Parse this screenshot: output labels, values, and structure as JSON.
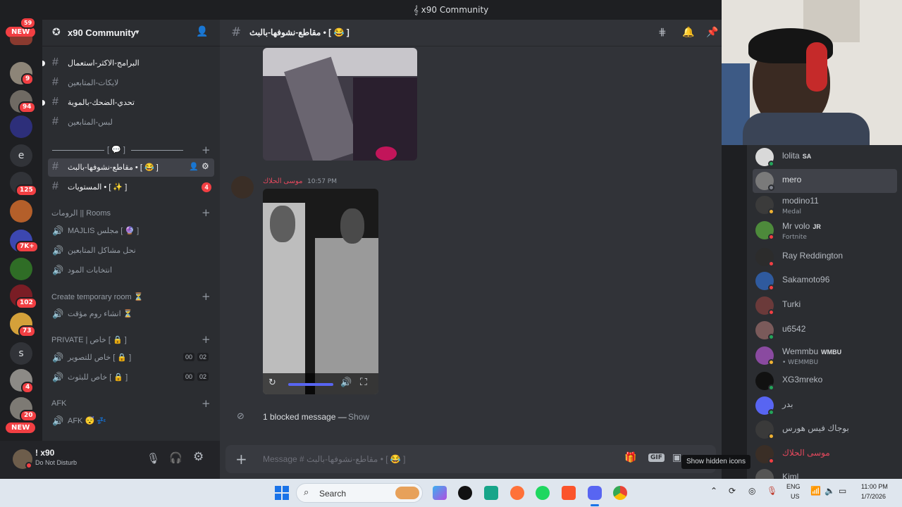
{
  "window": {
    "title": "x90 Community"
  },
  "server_rail": {
    "badges": [
      "59",
      "9",
      "94",
      "125",
      "7K+",
      "102",
      "73",
      "4",
      "20"
    ],
    "new_label": "NEW",
    "letters": [
      "e",
      "s"
    ]
  },
  "guild": {
    "name": "x90 Community"
  },
  "sidebar": {
    "channels_top": [
      {
        "label": "البرامج-الاكثر-استعمال",
        "unread": true
      },
      {
        "label": "لايكات-المتابعين",
        "unread": false
      },
      {
        "label": "تحدي-الضحك-بالموية",
        "unread": true
      },
      {
        "label": "لبس-المتابعين",
        "unread": false
      }
    ],
    "divider_category": "[ 💬 ]",
    "active_channel": "مقاطع-نشوفها-بالبث • [ 😂 ]",
    "levels_channel": "المستويات • [ ✨ ]",
    "levels_badge": "4",
    "rooms_category": "الرومات || Rooms",
    "voice_rooms": [
      "MAJLIS مجلس [ 🔮 ]",
      "نحل مشاكل المتابعين",
      "انتخابات المود"
    ],
    "temp_category": "Create temporary room ⏳",
    "temp_channel": "انشاء روم مؤقت ⏳",
    "private_category": "PRIVATE | خاص [ 🔒 ]",
    "private_channels": [
      {
        "label": "خاص للتصوير [ 🔒 ]",
        "count_a": "00",
        "count_b": "02"
      },
      {
        "label": "خاص للبثوث [ 🔒 ]",
        "count_a": "00",
        "count_b": "02"
      }
    ],
    "afk_category": "AFK",
    "afk_channel": "AFK 😴 💤"
  },
  "user_panel": {
    "name": "! x90",
    "status": "Do Not Disturb"
  },
  "channel_header": {
    "name": "مقاطع-نشوفها-بالبث • [ 😂 ]"
  },
  "chat": {
    "message": {
      "author": "موسى الحلاك",
      "time": "10:57 PM"
    },
    "blocked_text": "1 blocked message —",
    "blocked_show": "Show",
    "input_placeholder": "Message # مقاطع-نشوفها-بالبث • [ 😂 ]"
  },
  "tooltip": "Show hidden icons",
  "members": [
    {
      "name": "lolita",
      "tag": "SA"
    },
    {
      "name": "mero",
      "tag": ""
    },
    {
      "name": "modino11",
      "sub": "Medal"
    },
    {
      "name": "Mr volo",
      "tag": "JR",
      "sub": "Fortnite"
    },
    {
      "name": "Ray Reddington"
    },
    {
      "name": "Sakamoto96"
    },
    {
      "name": "Turki"
    },
    {
      "name": "u6542"
    },
    {
      "name": "Wemmbu",
      "tag": "WMBU",
      "sub": "• WEMMBU"
    },
    {
      "name": "XG3mreko"
    },
    {
      "name": "بدر"
    },
    {
      "name": "بوجاك فيس هورس"
    },
    {
      "name": "موسى الحلاك"
    },
    {
      "name": "Kiml"
    }
  ],
  "taskbar": {
    "search": "Search",
    "lang": "ENG",
    "region": "US",
    "time": "11:00 PM",
    "date": "1/7/2026"
  },
  "colors": {
    "accent": "#5865f2",
    "dnd": "#f23f43",
    "online": "#23a55a",
    "idle": "#f0b232"
  }
}
